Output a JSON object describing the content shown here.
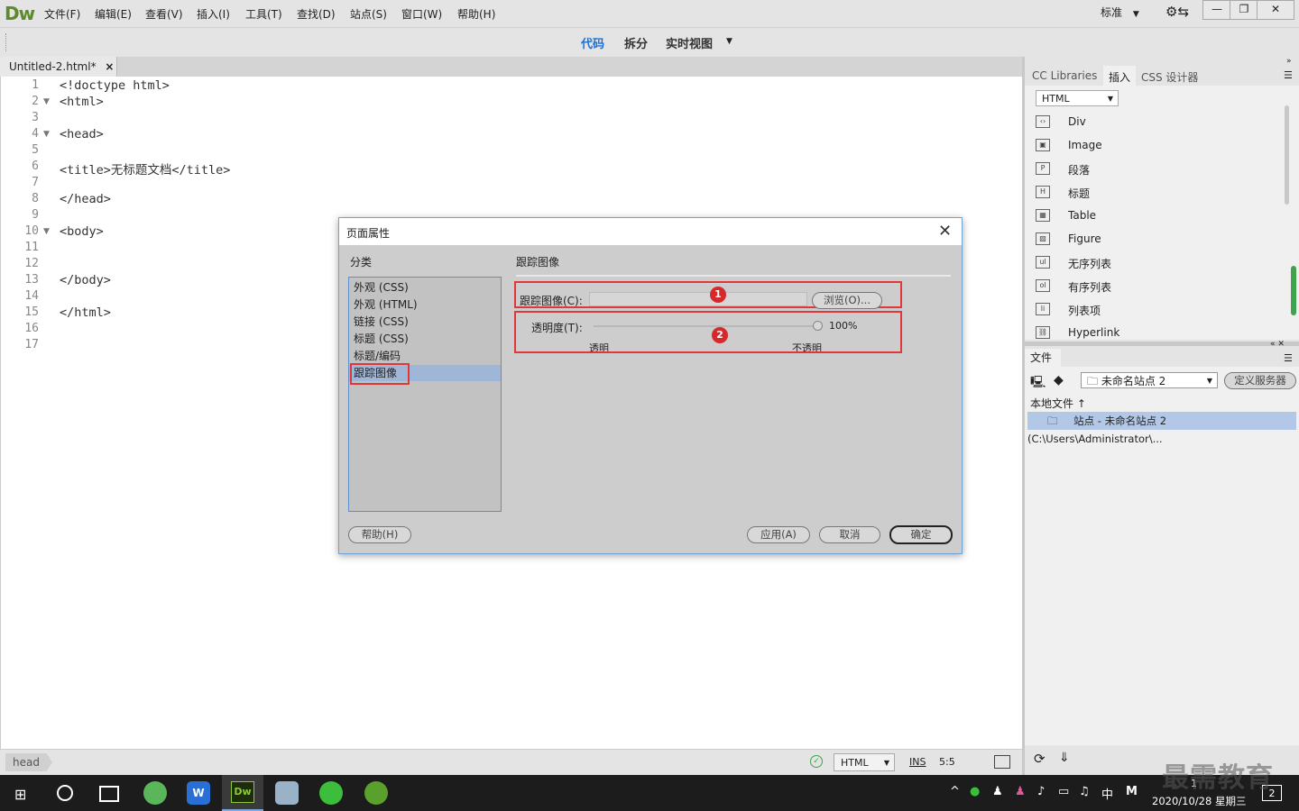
{
  "app": {
    "logo": "Dw",
    "menus": [
      "文件(F)",
      "编辑(E)",
      "查看(V)",
      "插入(I)",
      "工具(T)",
      "查找(D)",
      "站点(S)",
      "窗口(W)",
      "帮助(H)"
    ],
    "workspace": "标准",
    "window_buttons": [
      "—",
      "❐",
      "✕"
    ]
  },
  "viewbar": {
    "code": "代码",
    "split": "拆分",
    "live": "实时视图"
  },
  "document": {
    "tab_name": "Untitled-2.html*",
    "close": "×",
    "lines": [
      {
        "n": "1",
        "fold": false,
        "text": "<!doctype html>"
      },
      {
        "n": "2",
        "fold": true,
        "text": "<html>"
      },
      {
        "n": "3",
        "fold": false,
        "text": ""
      },
      {
        "n": "4",
        "fold": true,
        "text": "<head>"
      },
      {
        "n": "5",
        "fold": false,
        "text": ""
      },
      {
        "n": "6",
        "fold": false,
        "text": "<title>无标题文档</title>"
      },
      {
        "n": "7",
        "fold": false,
        "text": ""
      },
      {
        "n": "8",
        "fold": false,
        "text": "</head>"
      },
      {
        "n": "9",
        "fold": false,
        "text": ""
      },
      {
        "n": "10",
        "fold": true,
        "text": "<body>"
      },
      {
        "n": "11",
        "fold": false,
        "text": ""
      },
      {
        "n": "12",
        "fold": false,
        "text": ""
      },
      {
        "n": "13",
        "fold": false,
        "text": "</body>"
      },
      {
        "n": "14",
        "fold": false,
        "text": ""
      },
      {
        "n": "15",
        "fold": false,
        "text": "</html>"
      },
      {
        "n": "16",
        "fold": false,
        "text": ""
      },
      {
        "n": "17",
        "fold": false,
        "text": ""
      }
    ]
  },
  "statusbar": {
    "tag": "head",
    "language": "HTML",
    "mode": "INS",
    "position": "5:5"
  },
  "right_panel": {
    "tabs": [
      "CC Libraries",
      "插入",
      "CSS 设计器"
    ],
    "insert_category": "HTML",
    "insert_items": [
      {
        "icon": "div-icon",
        "glyph": "‹›",
        "label": "Div"
      },
      {
        "icon": "image-icon",
        "glyph": "▣",
        "label": "Image"
      },
      {
        "icon": "paragraph-icon",
        "glyph": "P",
        "label": "段落"
      },
      {
        "icon": "heading-icon",
        "glyph": "H",
        "label": "标题"
      },
      {
        "icon": "table-icon",
        "glyph": "▦",
        "label": "Table"
      },
      {
        "icon": "figure-icon",
        "glyph": "▨",
        "label": "Figure"
      },
      {
        "icon": "ul-icon",
        "glyph": "ul",
        "label": "无序列表"
      },
      {
        "icon": "ol-icon",
        "glyph": "ol",
        "label": "有序列表"
      },
      {
        "icon": "li-icon",
        "glyph": "li",
        "label": "列表项"
      },
      {
        "icon": "hyperlink-icon",
        "glyph": "⛓",
        "label": "Hyperlink"
      }
    ],
    "files_tab": "文件",
    "site_select": "未命名站点 2",
    "define_server": "定义服务器",
    "local_files": "本地文件 ↑",
    "site_row": "站点 - 未命名站点 2 (C:\\Users\\Administrator\\..."
  },
  "dialog": {
    "title": "页面属性",
    "category_label": "分类",
    "categories": [
      "外观 (CSS)",
      "外观 (HTML)",
      "链接 (CSS)",
      "标题 (CSS)",
      "标题/编码",
      "跟踪图像"
    ],
    "selected_index": 5,
    "section_title": "跟踪图像",
    "tracing_label": "跟踪图像(C):",
    "browse": "浏览(O)...",
    "opacity_label": "透明度(T):",
    "opacity_value": "100%",
    "opacity_fraction": 1.0,
    "transparent": "透明",
    "opaque": "不透明",
    "badge1": "1",
    "badge2": "2",
    "help": "帮助(H)",
    "apply": "应用(A)",
    "cancel": "取消",
    "ok": "确定"
  },
  "taskbar": {
    "clock_time": "1",
    "clock_date": "2020/10/28 星期三",
    "ime": "中",
    "ime2": "M",
    "notification_count": "2"
  },
  "watermark": "最需教育"
}
